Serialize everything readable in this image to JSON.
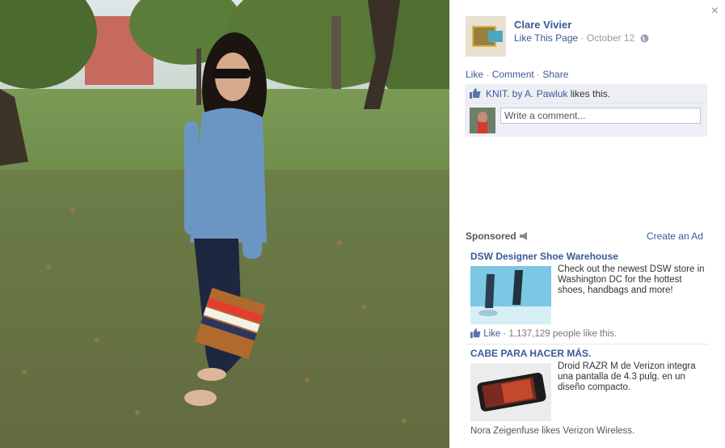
{
  "photo": {
    "description_icon": "photo-of-woman-in-park"
  },
  "panel": {
    "close_label": "×",
    "page_name": "Clare Vivier",
    "like_page_label": "Like This Page",
    "separator": " · ",
    "date": "October 12",
    "globe_icon": "globe-icon",
    "actions": {
      "like": "Like",
      "comment": "Comment",
      "share": "Share",
      "sep": " · "
    },
    "likes_text_link": "KNIT. by A. Pawluk",
    "likes_text_rest": " likes this.",
    "comment_placeholder": "Write a comment..."
  },
  "sponsored": {
    "label": "Sponsored",
    "create_ad": "Create an Ad",
    "ads": [
      {
        "title": "DSW Designer Shoe Warehouse",
        "body": "Check out the newest DSW store in Washington DC for the hottest shoes, handbags and more!",
        "like_label": "Like",
        "like_count": " · 1,137,129 people like this."
      },
      {
        "title": "CABE PARA HACER MÁS.",
        "body": "Droid RAZR M de Verizon integra una pantalla de 4.3 pulg. en un diseño compacto.",
        "social": "Nora Zeigenfuse likes Verizon Wireless."
      }
    ]
  },
  "colors": {
    "link": "#3b5998",
    "panel_bg": "#edeff4"
  }
}
